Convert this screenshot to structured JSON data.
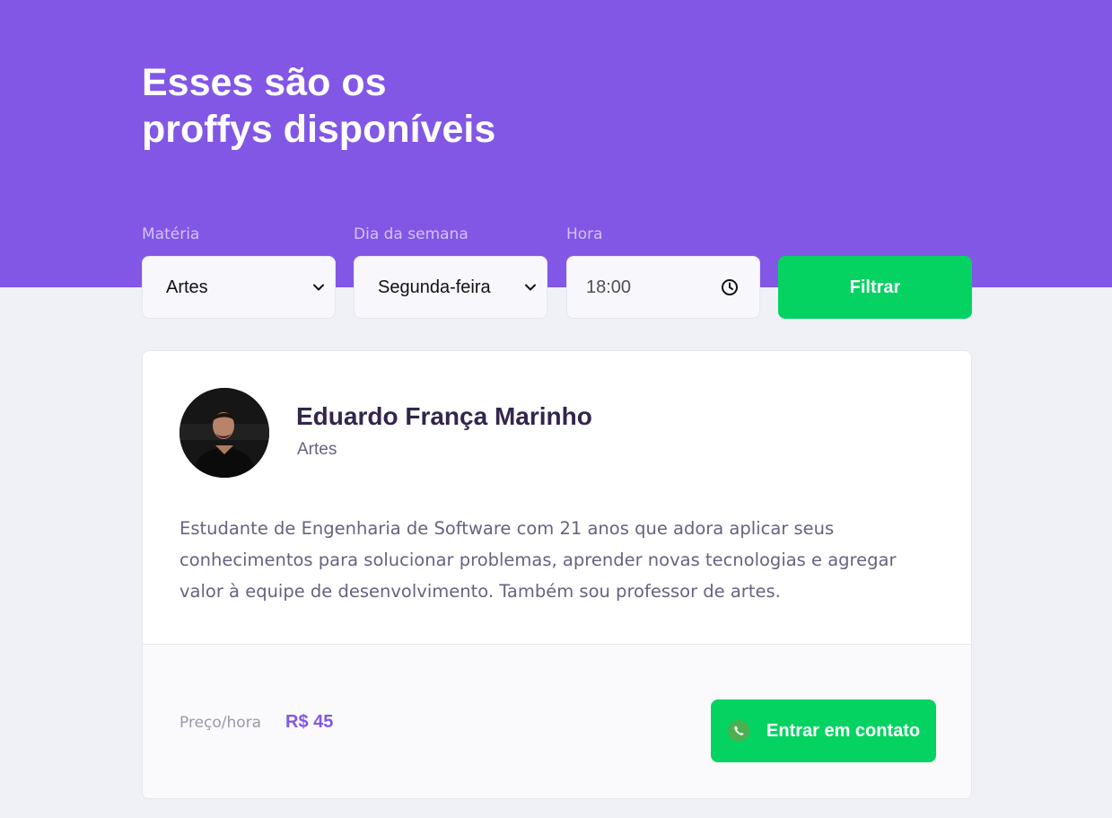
{
  "header": {
    "title_line1": "Esses são os",
    "title_line2": "proffys disponíveis"
  },
  "filters": {
    "subject": {
      "label": "Matéria",
      "value": "Artes"
    },
    "weekday": {
      "label": "Dia da semana",
      "value": "Segunda-feira"
    },
    "time": {
      "label": "Hora",
      "value": "18:00"
    },
    "submit_label": "Filtrar"
  },
  "teacher": {
    "name": "Eduardo França Marinho",
    "subject": "Artes",
    "bio_line1": "Estudante de Engenharia de Software com 21 anos que adora aplicar seus",
    "bio_line2": "conhecimentos para solucionar problemas, aprender novas tecnologias e agregar",
    "bio_line3": "valor à equipe de desenvolvimento. Também sou professor de artes.",
    "price_label": "Preço/hora",
    "price_value": "R$ 45",
    "contact_label": "Entrar em contato"
  },
  "colors": {
    "primary": "#8257E5",
    "secondary": "#04D361",
    "background": "#F0F0F7",
    "title_dark": "#32264D",
    "text_body": "#6A6180"
  },
  "icons": {
    "select_arrow": "chevron-down-icon",
    "time": "clock-icon",
    "contact": "whatsapp-icon"
  }
}
